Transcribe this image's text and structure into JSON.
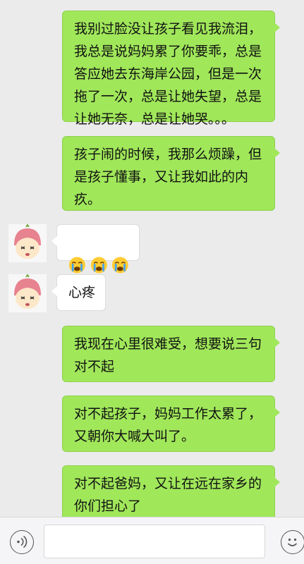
{
  "messages": [
    {
      "side": "right",
      "text": "我别过脸没让孩子看见我流泪，\n我总是说妈妈累了你要乖，总是\n答应她去东海岸公园，但是一次\n拖了一次，总是让她失望，总是\n让她无奈，总是让她哭。。。"
    },
    {
      "side": "right",
      "text": "孩子闹的时候，我那么烦躁，但\n是孩子懂事，又让我如此的内\n疚。"
    },
    {
      "side": "left",
      "emoji": [
        "crying-face",
        "crying-face",
        "crying-face"
      ]
    },
    {
      "side": "left",
      "text": "心疼"
    },
    {
      "side": "right",
      "text": "我现在心里很难受，想要说三句\n对不起"
    },
    {
      "side": "right",
      "text": "对不起孩子，妈妈工作太累了，\n又朝你大喊大叫了。"
    },
    {
      "side": "right",
      "text": "对不起爸妈，又让在远在家乡的\n你们担心了"
    }
  ],
  "input_bar": {
    "voice_icon": "voice-wave-icon",
    "emoji_icon": "smiley-icon",
    "input_value": ""
  },
  "colors": {
    "background": "#ebebeb",
    "self_bubble": "#a0e75a",
    "other_bubble": "#ffffff",
    "avatar_hair": "#e7828f"
  }
}
